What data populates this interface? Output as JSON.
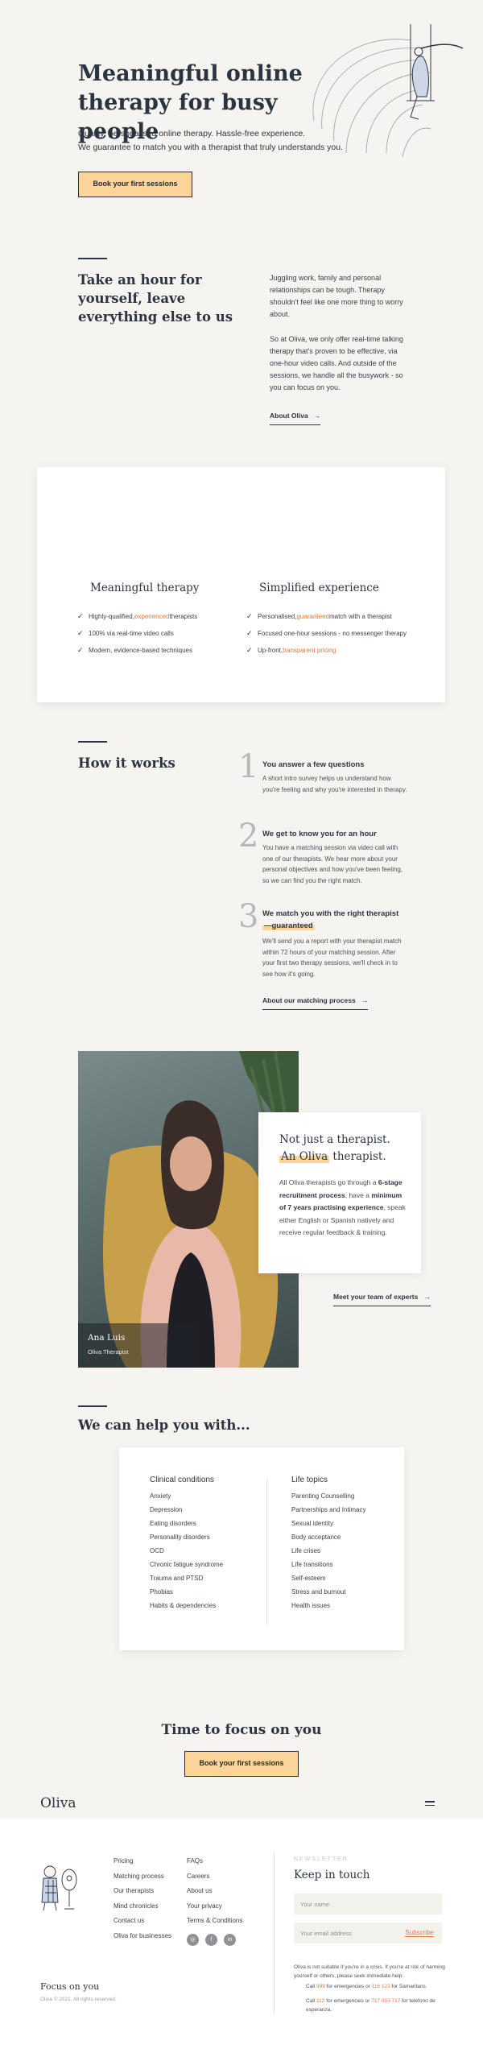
{
  "hero": {
    "title": "Meaningful online therapy for busy people",
    "subtitle_line1": "Quality, personalised online therapy. Hassle-free experience.",
    "subtitle_line2": "We guarantee to match you with a therapist that truly understands you.",
    "cta": "Book your first sessions"
  },
  "intro": {
    "title": "Take an hour for yourself, leave everything else to us",
    "p1": "Juggling work, family and personal relationships can be tough. Therapy shouldn't feel like one more thing to worry about.",
    "p2": "So at Oliva, we only offer real-time talking therapy that's proven to be effective, via one-hour video calls. And outside of the sessions, we handle all the busywork - so you can focus on you.",
    "link": "About Oliva"
  },
  "features": {
    "left": {
      "title": "Meaningful therapy",
      "items": [
        {
          "pre": "Highly-qualified, ",
          "hl": "experienced",
          "post": " therapists"
        },
        {
          "pre": "100% via real-time video calls",
          "hl": "",
          "post": ""
        },
        {
          "pre": "Modern, evidence-based techniques",
          "hl": "",
          "post": ""
        }
      ]
    },
    "right": {
      "title": "Simplified experience",
      "items": [
        {
          "pre": "Personalised, ",
          "hl": "guaranteed",
          "post": " match with a therapist"
        },
        {
          "pre": "Focused one-hour sessions - no messenger therapy",
          "hl": "",
          "post": ""
        },
        {
          "pre": "Up-front, ",
          "hl": "transparent pricing",
          "post": ""
        }
      ]
    }
  },
  "how": {
    "title": "How it works",
    "steps": [
      {
        "num": "1",
        "title": "You answer a few questions",
        "text": "A short intro survey helps us understand how you're feeling and why you're interested in therapy."
      },
      {
        "num": "2",
        "title": "We get to know you for an hour",
        "text": "You have a matching session via video call with one of our therapists. We hear more about your personal objectives and how you've been feeling, so we can find you the right match."
      },
      {
        "num": "3",
        "title": "We match you with the right therapist",
        "title_hl": "—guaranteed",
        "text": "We'll send you a report with your therapist match within 72 hours of your matching session. After your first two therapy sessions, we'll check in to see how it's going."
      }
    ],
    "link": "About our matching process"
  },
  "therapist": {
    "name": "Ana Luis",
    "role": "Oliva Therapist",
    "quote_line1": "Not just a therapist.",
    "quote_hl": "An Oliva",
    "quote_line2_post": " therapist.",
    "body_pre": "All Oliva therapists go through a ",
    "body_b1": "6-stage recruitment process",
    "body_mid": ", have a ",
    "body_b2": "minimum of 7 years practising experience",
    "body_post": ", speak either English or Spanish natively and receive regular feedback & training.",
    "link": "Meet your team of experts"
  },
  "help": {
    "title": "We can help you with...",
    "clinical_title": "Clinical conditions",
    "clinical": [
      "Anxiety",
      "Depression",
      "Eating disorders",
      "Personality disorders",
      "OCD",
      "Chronic fatigue syndrome",
      "Trauma and PTSD",
      "Phobias",
      "Habits & dependencies"
    ],
    "life_title": "Life topics",
    "life": [
      "Parenting Counselling",
      "Partnerships and Intimacy",
      "Sexual identity",
      "Body acceptance",
      "Life crises",
      "Life transitions",
      "Self-esteem",
      "Stress and burnout",
      "Health issues"
    ]
  },
  "cta": {
    "title": "Time to focus on you",
    "button": "Book your first sessions"
  },
  "footer": {
    "logo": "Oliva",
    "col1": [
      "Pricing",
      "Matching process",
      "Our therapists",
      "Mind chronicles",
      "Contact us",
      "Oliva for businesses"
    ],
    "col2": [
      "FAQs",
      "Careers",
      "About us",
      "Your privacy",
      "Terms & Conditions"
    ],
    "newsletter_label": "NEWSLETTER",
    "newsletter_title": "Keep in touch",
    "name_placeholder": "Your name",
    "email_placeholder": "Your email address",
    "subscribe": "Subscribe",
    "disclaimer": "Oliva is not suitable if you're in a crisis. If you're at risk of harming yourself or others, please seek immediate help.",
    "uk_pre": "Call ",
    "uk_num1": "999",
    "uk_mid": " for emergencies or ",
    "uk_num2": "116 123",
    "uk_post": " for Samaritans.",
    "es_pre": "Call ",
    "es_num1": "112",
    "es_mid": " for emergencies or ",
    "es_num2": "717 003 717",
    "es_post": " for teléfono de esperanza.",
    "tagline": "Focus on you",
    "copyright": "Oliva © 2021. All rights reserved."
  }
}
